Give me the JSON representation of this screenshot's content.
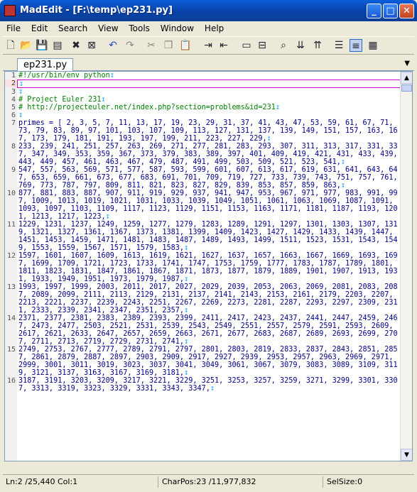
{
  "window": {
    "title": "MadEdit - [F:\\temp\\ep231.py]",
    "min": "_",
    "max": "□",
    "close": "✕"
  },
  "menu": [
    "File",
    "Edit",
    "Search",
    "View",
    "Tools",
    "Window",
    "Help"
  ],
  "toolbar_icons": [
    "new-file-icon",
    "open-file-icon",
    "save-icon",
    "save-all-icon",
    "close-file-icon",
    "close-all-icon",
    "undo-icon",
    "redo-icon",
    "cut-icon",
    "copy-icon",
    "paste-icon",
    "indent-icon",
    "outdent-icon",
    "comment-icon",
    "uncomment-icon",
    "find-icon",
    "find-next-icon",
    "find-prev-icon",
    "text-mode-icon",
    "column-mode-icon",
    "hex-mode-icon"
  ],
  "tab": {
    "label": "ep231.py",
    "menu_icon": "▼"
  },
  "eol_mark": "↧",
  "lines": [
    {
      "no": "1",
      "text": "#!/usr/bin/env python",
      "type": "com"
    },
    {
      "no": "2",
      "text": "",
      "type": "cur"
    },
    {
      "no": "3",
      "text": "",
      "type": "com"
    },
    {
      "no": "4",
      "text": "# Project Euler 231",
      "type": "com"
    },
    {
      "no": "5",
      "text": "# http://projecteuler.net/index.php?section=problems&id=231",
      "type": "com"
    },
    {
      "no": "6",
      "text": "",
      "type": "com"
    },
    {
      "no": "7",
      "text": "primes = [ 2, 3, 5, 7, 11, 13, 17, 19, 23, 29, 31, 37, 41, 43, 47, 53, 59, 61, 67, 71, 73, 79, 83, 89, 97, 101, 103, 107, 109, 113, 127, 131, 137, 139, 149, 151, 157, 163, 167, 173, 179, 181, 191, 193, 197, 199, 211, 223, 227, 229,",
      "type": "code"
    },
    {
      "no": "8",
      "text": "233, 239, 241, 251, 257, 263, 269, 271, 277, 281, 283, 293, 307, 311, 313, 317, 331, 337, 347, 349, 353, 359, 367, 373, 379, 383, 389, 397, 401, 409, 419, 421, 431, 433, 439, 443, 449, 457, 461, 463, 467, 479, 487, 491, 499, 503, 509, 521, 523, 541,",
      "type": "code"
    },
    {
      "no": "9",
      "text": "547, 557, 563, 569, 571, 577, 587, 593, 599, 601, 607, 613, 617, 619, 631, 641, 643, 647, 653, 659, 661, 673, 677, 683, 691, 701, 709, 719, 727, 733, 739, 743, 751, 757, 761, 769, 773, 787, 797, 809, 811, 821, 823, 827, 829, 839, 853, 857, 859, 863,",
      "type": "code"
    },
    {
      "no": "10",
      "text": "877, 881, 883, 887, 907, 911, 919, 929, 937, 941, 947, 953, 967, 971, 977, 983, 991, 997, 1009, 1013, 1019, 1021, 1031, 1033, 1039, 1049, 1051, 1061, 1063, 1069, 1087, 1091, 1093, 1097, 1103, 1109, 1117, 1123, 1129, 1151, 1153, 1163, 1171, 1181, 1187, 1193, 1201, 1213, 1217, 1223,",
      "type": "code"
    },
    {
      "no": "11",
      "text": "1229, 1231, 1237, 1249, 1259, 1277, 1279, 1283, 1289, 1291, 1297, 1301, 1303, 1307, 1319, 1321, 1327, 1361, 1367, 1373, 1381, 1399, 1409, 1423, 1427, 1429, 1433, 1439, 1447, 1451, 1453, 1459, 1471, 1481, 1483, 1487, 1489, 1493, 1499, 1511, 1523, 1531, 1543, 1549, 1553, 1559, 1567, 1571, 1579, 1583,",
      "type": "code"
    },
    {
      "no": "12",
      "text": "1597, 1601, 1607, 1609, 1613, 1619, 1621, 1627, 1637, 1657, 1663, 1667, 1669, 1693, 1697, 1699, 1709, 1721, 1723, 1733, 1741, 1747, 1753, 1759, 1777, 1783, 1787, 1789, 1801, 1811, 1823, 1831, 1847, 1861, 1867, 1871, 1873, 1877, 1879, 1889, 1901, 1907, 1913, 1931, 1933, 1949, 1951, 1973, 1979, 1987,",
      "type": "code"
    },
    {
      "no": "13",
      "text": "1993, 1997, 1999, 2003, 2011, 2017, 2027, 2029, 2039, 2053, 2063, 2069, 2081, 2083, 2087, 2089, 2099, 2111, 2113, 2129, 2131, 2137, 2141, 2143, 2153, 2161, 2179, 2203, 2207, 2213, 2221, 2237, 2239, 2243, 2251, 2267, 2269, 2273, 2281, 2287, 2293, 2297, 2309, 2311, 2333, 2339, 2341, 2347, 2351, 2357,",
      "type": "code"
    },
    {
      "no": "14",
      "text": "2371, 2377, 2381, 2383, 2389, 2393, 2399, 2411, 2417, 2423, 2437, 2441, 2447, 2459, 2467, 2473, 2477, 2503, 2521, 2531, 2539, 2543, 2549, 2551, 2557, 2579, 2591, 2593, 2609, 2617, 2621, 2633, 2647, 2657, 2659, 2663, 2671, 2677, 2683, 2687, 2689, 2693, 2699, 2707, 2711, 2713, 2719, 2729, 2731, 2741,",
      "type": "code"
    },
    {
      "no": "15",
      "text": "2749, 2753, 2767, 2777, 2789, 2791, 2797, 2801, 2803, 2819, 2833, 2837, 2843, 2851, 2857, 2861, 2879, 2887, 2897, 2903, 2909, 2917, 2927, 2939, 2953, 2957, 2963, 2969, 2971, 2999, 3001, 3011, 3019, 3023, 3037, 3041, 3049, 3061, 3067, 3079, 3083, 3089, 3109, 3119, 3121, 3137, 3163, 3167, 3169, 3181,",
      "type": "code"
    },
    {
      "no": "16",
      "text": "3187, 3191, 3203, 3209, 3217, 3221, 3229, 3251, 3253, 3257, 3259, 3271, 3299, 3301, 3307, 3313, 3319, 3323, 3329, 3331, 3343, 3347,",
      "type": "code"
    }
  ],
  "status": {
    "position": "Ln:2 /25,440 Col:1",
    "charpos": "CharPos:23 /11,977,832",
    "selsize": "SelSize:0"
  }
}
